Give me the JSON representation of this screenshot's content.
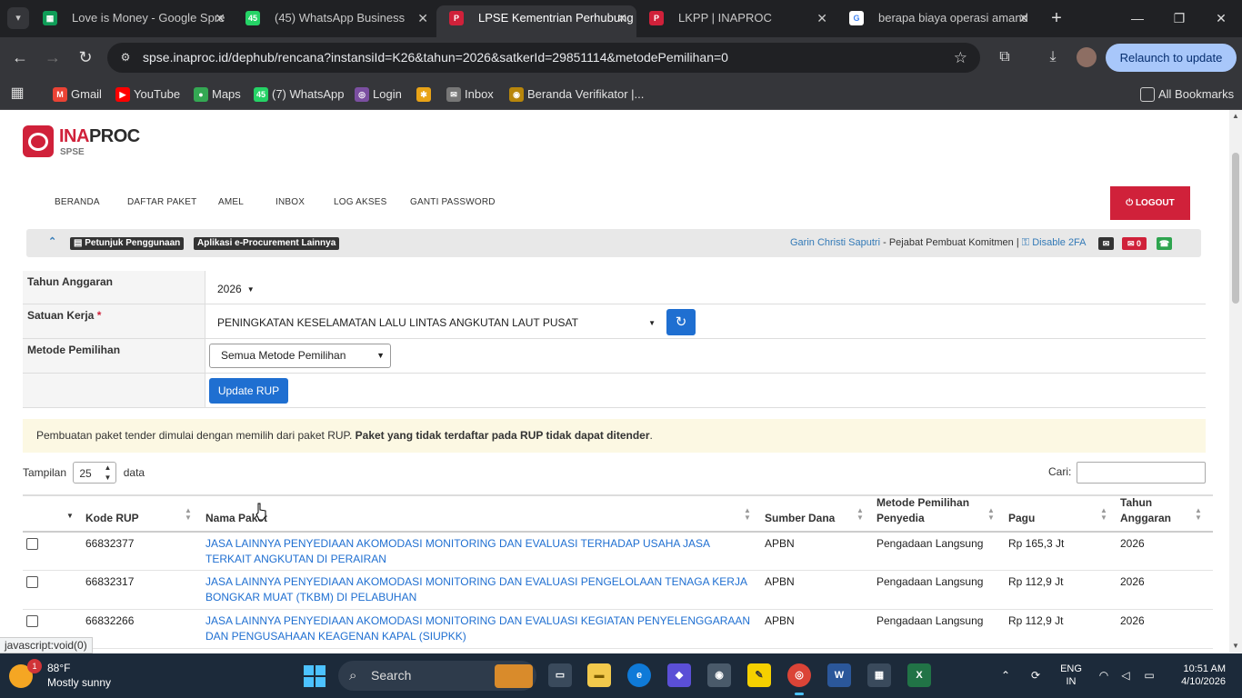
{
  "browser": {
    "tabs": [
      {
        "title": "Love is Money - Google Spre",
        "favicon": "G",
        "color": "#0f9d58"
      },
      {
        "title": "(45) WhatsApp Business",
        "favicon": "45",
        "color": "#25d366"
      },
      {
        "title": "LPSE Kementrian Perhubung",
        "favicon": "P",
        "color": "#d0213a"
      },
      {
        "title": "LKPP | INAPROC",
        "favicon": "P",
        "color": "#d0213a"
      },
      {
        "title": "berapa biaya operasi amand",
        "favicon": "G",
        "color": "#ffffff"
      }
    ],
    "url": "spse.inaproc.id/dephub/rencana?instansiId=K26&tahun=2026&satkerId=29851114&metodePemilihan=0",
    "relaunch_label": "Relaunch to update",
    "bookmarks": [
      {
        "label": "Gmail",
        "icon": "M",
        "color": "#ea4335"
      },
      {
        "label": "YouTube",
        "icon": "▶",
        "color": "#ff0000"
      },
      {
        "label": "Maps",
        "icon": "●",
        "color": "#34a853"
      },
      {
        "label": "(7) WhatsApp",
        "icon": "45",
        "color": "#25d366"
      },
      {
        "label": "Login",
        "icon": "◎",
        "color": "#7b4fa1"
      },
      {
        "label": "",
        "icon": "✱",
        "color": "#e8a317"
      },
      {
        "label": "Inbox",
        "icon": "✉",
        "color": "#777777"
      },
      {
        "label": "Beranda Verifikator |...",
        "icon": "◉",
        "color": "#b8860b"
      }
    ],
    "all_bookmarks_label": "All Bookmarks",
    "status_url": "javascript:void(0)"
  },
  "header": {
    "logo_brand_a": "INA",
    "logo_brand_b": "PROC",
    "logo_sub": "SPSE",
    "nav": [
      "BERANDA",
      "DAFTAR PAKET",
      "AMEL",
      "INBOX",
      "LOG AKSES",
      "GANTI PASSWORD"
    ],
    "logout_label": "LOGOUT"
  },
  "infobar": {
    "guide_label": "Petunjuk Penggunaan",
    "apps_label": "Aplikasi e-Procurement Lainnya",
    "user_name": "Garin Christi Saputri",
    "user_role": " - Pejabat Pembuat Komitmen | ",
    "disable_2fa": "Disable 2FA",
    "inbox_count": "0"
  },
  "form": {
    "tahun_label": "Tahun Anggaran",
    "tahun_value": "2026",
    "satker_label": "Satuan Kerja",
    "satker_required": "*",
    "satker_value": "PENINGKATAN KESELAMATAN LALU LINTAS ANGKUTAN LAUT PUSAT",
    "metode_label": "Metode Pemilihan",
    "metode_value": "Semua Metode Pemilihan",
    "update_label": "Update RUP"
  },
  "alert": {
    "text": "Pembuatan paket tender dimulai dengan memilih dari paket RUP. ",
    "bold": "Paket yang tidak terdaftar pada RUP tidak dapat ditender",
    "end": "."
  },
  "table_controls": {
    "show_label": "Tampilan",
    "page_length": "25",
    "data_label": "data",
    "search_label": "Cari:"
  },
  "table": {
    "headers": [
      "Kode RUP",
      "Nama Paket",
      "Sumber Dana",
      "Metode Pemilihan Penyedia",
      "Pagu",
      "Tahun Anggaran"
    ],
    "rows": [
      {
        "kode": "66832377",
        "nama": "JASA LAINNYA PENYEDIAAN AKOMODASI MONITORING DAN EVALUASI TERHADAP USAHA JASA TERKAIT ANGKUTAN DI PERAIRAN",
        "sumber": "APBN",
        "metode": "Pengadaan Langsung",
        "pagu": "Rp 165,3 Jt",
        "tahun": "2026"
      },
      {
        "kode": "66832317",
        "nama": "JASA LAINNYA PENYEDIAAN AKOMODASI MONITORING DAN EVALUASI PENGELOLAAN TENAGA KERJA BONGKAR MUAT (TKBM) DI PELABUHAN",
        "sumber": "APBN",
        "metode": "Pengadaan Langsung",
        "pagu": "Rp 112,9 Jt",
        "tahun": "2026"
      },
      {
        "kode": "66832266",
        "nama": "JASA LAINNYA PENYEDIAAN AKOMODASI MONITORING DAN EVALUASI KEGIATAN PENYELENGGARAAN DAN PENGUSAHAAN KEAGENAN KAPAL (SIUPKK)",
        "sumber": "APBN",
        "metode": "Pengadaan Langsung",
        "pagu": "Rp 112,9 Jt",
        "tahun": "2026"
      }
    ]
  },
  "taskbar": {
    "temperature": "88°F",
    "condition": "Mostly sunny",
    "weather_badge": "1",
    "search_placeholder": "Search",
    "lang_a": "ENG",
    "lang_b": "IN",
    "time": "10:51 AM",
    "date": "4/10/2026"
  }
}
